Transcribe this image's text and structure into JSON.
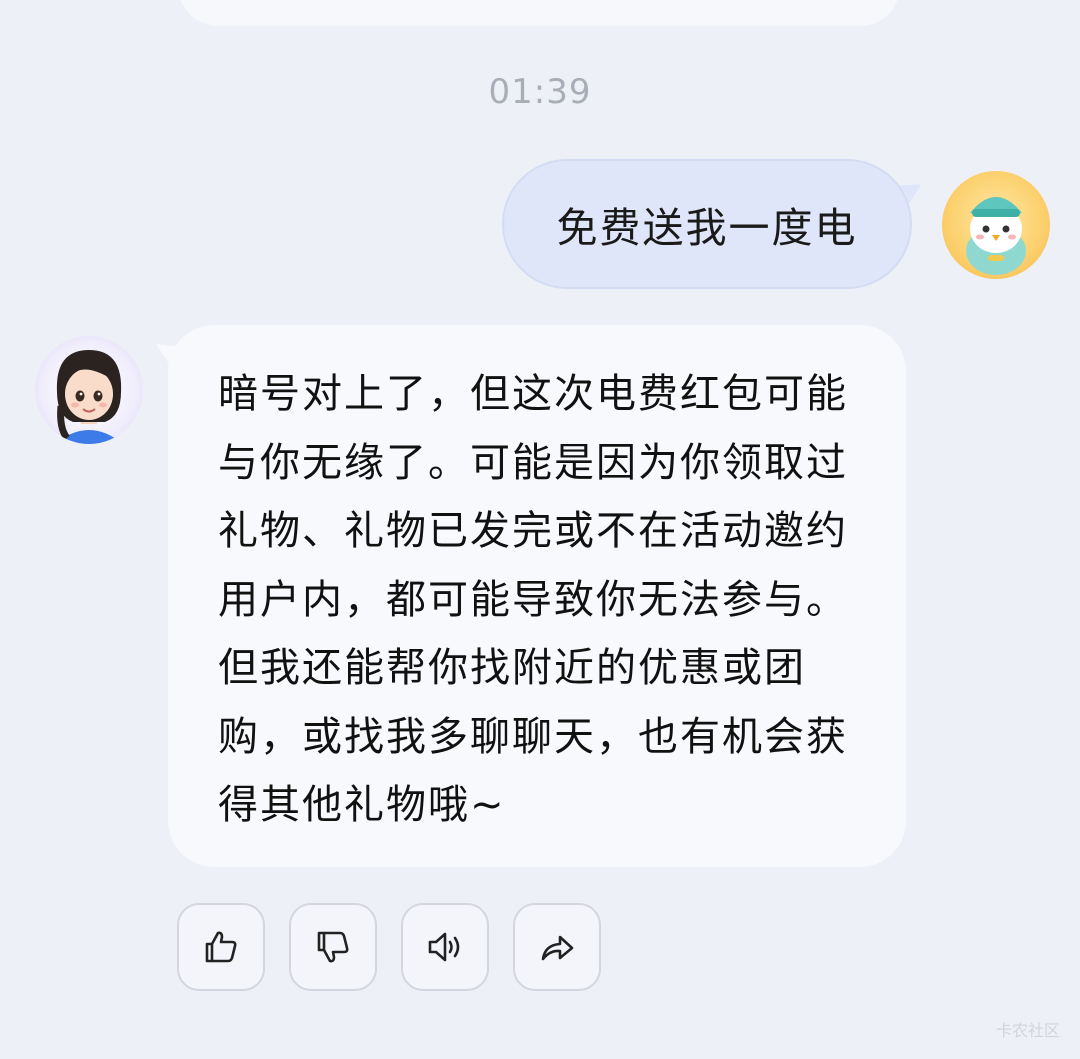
{
  "conversation": {
    "timestamp": "01:39",
    "user_message": "免费送我一度电",
    "bot_message": "暗号对上了，但这次电费红包可能与你无缘了。可能是因为你领取过礼物、礼物已发完或不在活动邀约用户内，都可能导致你无法参与。但我还能帮你找附近的优惠或团购，或找我多聊聊天，也有机会获得其他礼物哦~"
  },
  "actions": [
    {
      "name": "like",
      "icon": "thumbs-up-icon"
    },
    {
      "name": "dislike",
      "icon": "thumbs-down-icon"
    },
    {
      "name": "read-aloud",
      "icon": "speaker-icon"
    },
    {
      "name": "share",
      "icon": "share-arrow-icon"
    }
  ],
  "watermark": "卡农社区",
  "colors": {
    "background": "#eef0f7",
    "user_bubble": "#dfe6fa",
    "bot_bubble": "#f8f9fd",
    "timestamp": "#a9adb8"
  }
}
